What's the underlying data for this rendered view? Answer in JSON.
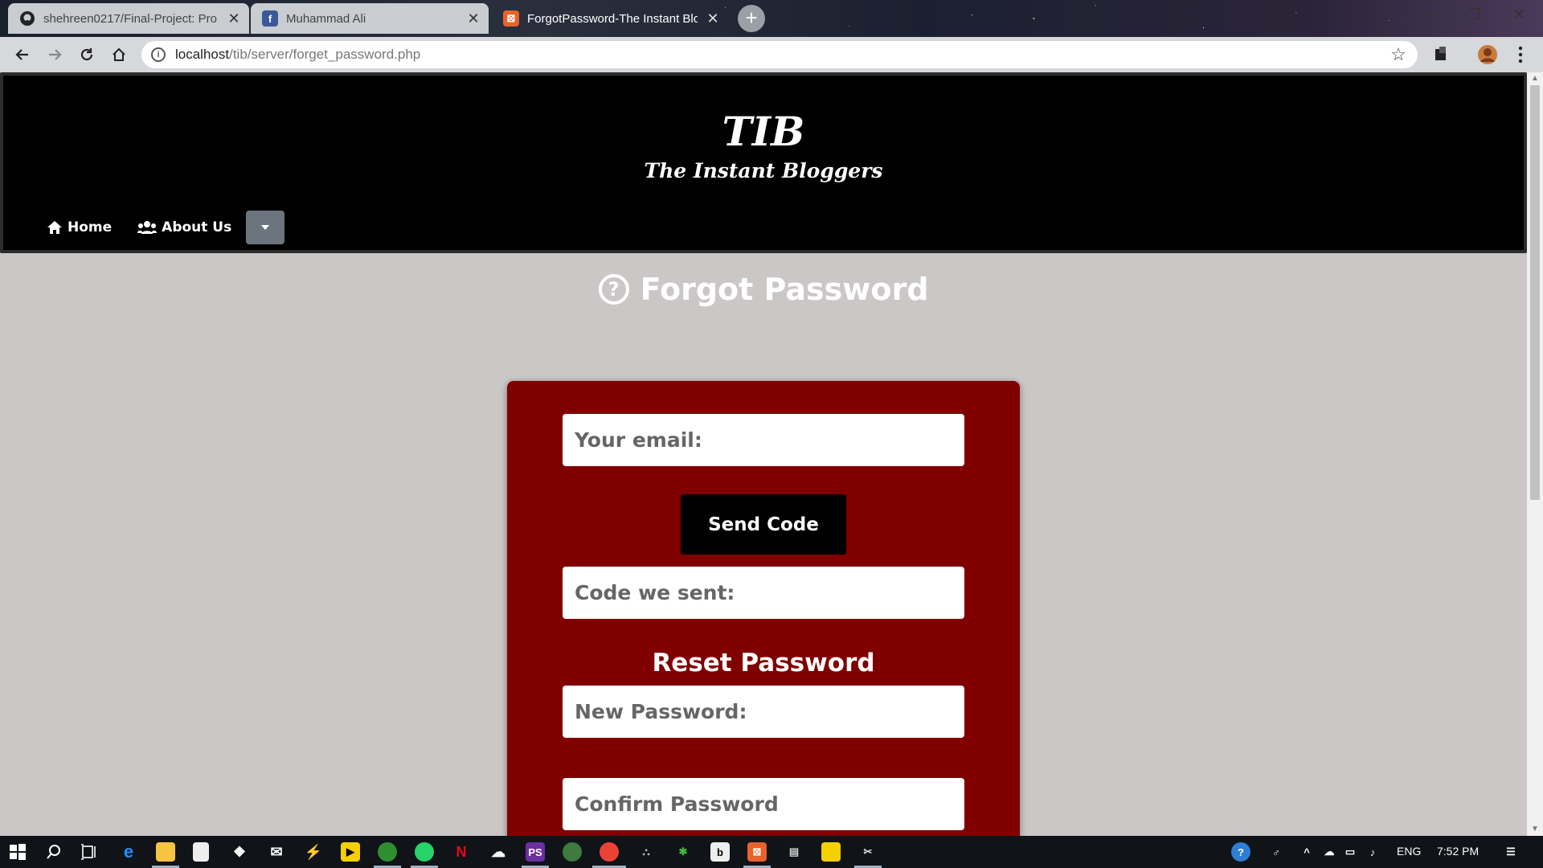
{
  "browser": {
    "tabs": [
      {
        "title": "shehreen0217/Final-Project: Pro",
        "favicon": "github-icon"
      },
      {
        "title": "Muhammad Ali",
        "favicon": "facebook-icon"
      },
      {
        "title": "ForgotPassword-The Instant Blo",
        "favicon": "xampp-icon",
        "active": true
      }
    ],
    "url_host": "localhost",
    "url_path": "/tib/server/forget_password.php",
    "info_glyph": "i",
    "new_tab_glyph": "+",
    "close_glyph": "✕",
    "star_glyph": "☆"
  },
  "site": {
    "logo_text": "TIB",
    "tagline": "The Instant Bloggers",
    "nav": [
      {
        "label": "Home",
        "icon": "home-icon"
      },
      {
        "label": "About Us",
        "icon": "users-icon"
      }
    ],
    "dropdown_icon": "caret-down-icon"
  },
  "page": {
    "title": "Forgot Password",
    "title_icon_glyph": "?",
    "form": {
      "email_placeholder": "Your email:",
      "send_button": "Send Code",
      "code_placeholder": "Code we sent:",
      "reset_heading": "Reset Password",
      "new_password_placeholder": "New Password:",
      "confirm_password_placeholder": "Confirm Password"
    }
  },
  "taskbar": {
    "language": "ENG",
    "time": "7:52 PM"
  },
  "colors": {
    "card": "#800000",
    "page_bg": "#cac7c6",
    "header_bg": "#000000",
    "dropdown_btn": "#6c757d"
  }
}
